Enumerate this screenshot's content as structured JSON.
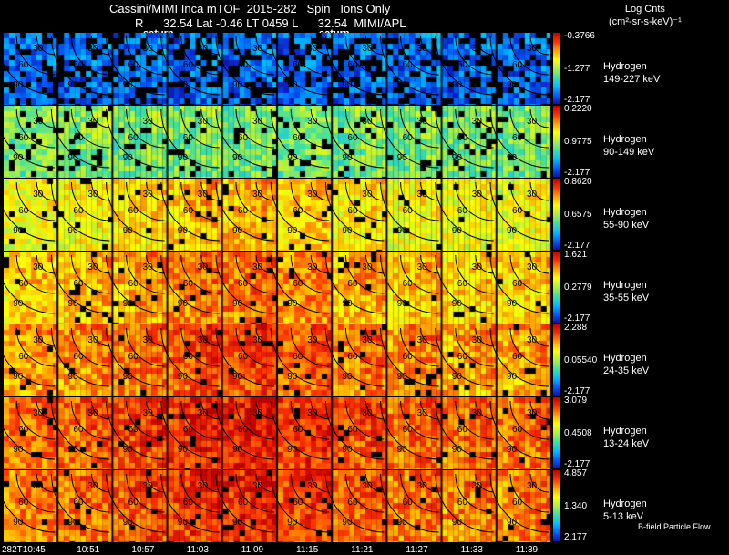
{
  "header": {
    "title": "Cassini/MIMI Inca mTOF  2015-282   Spin   Ions Only",
    "subtitle": "R      32.54 Lat -0.46 LT 0459 L      32.54  MIMI/APL",
    "colorbar_title": "Log Cnts",
    "colorbar_units": "(cm²-sr-s-keV)⁻¹"
  },
  "overlay_labels": [
    "saturn",
    "saturn"
  ],
  "chart_data": {
    "type": "heatmap",
    "time_ticks": [
      "282T10:45",
      "10:51",
      "10:57",
      "11:03",
      "11:09",
      "11:15",
      "11:21",
      "11:27",
      "11:33",
      "11:39"
    ],
    "contour_labels": [
      "30",
      "60",
      "90"
    ],
    "panels": [
      {
        "species": "Hydrogen",
        "energy": "149-227 keV",
        "cb_max": "-0.3766",
        "cb_mid": "-1.277",
        "cb_min": "-2.177"
      },
      {
        "species": "Hydrogen",
        "energy": "90-149 keV",
        "cb_max": "0.2220",
        "cb_mid": "0.9775",
        "cb_min": "-2.177"
      },
      {
        "species": "Hydrogen",
        "energy": "55-90 keV",
        "cb_max": "0.8620",
        "cb_mid": "0.6575",
        "cb_min": "-2.177"
      },
      {
        "species": "Hydrogen",
        "energy": "35-55 keV",
        "cb_max": "1.621",
        "cb_mid": "0.2779",
        "cb_min": "-2.177"
      },
      {
        "species": "Hydrogen",
        "energy": "24-35 keV",
        "cb_max": "2.288",
        "cb_mid": "0.05540",
        "cb_min": "-2.177"
      },
      {
        "species": "Hydrogen",
        "energy": "13-24 keV",
        "cb_max": "3.079",
        "cb_mid": "0.4508",
        "cb_min": "-2.177"
      },
      {
        "species": "Hydrogen",
        "energy": "5-13 keV",
        "cb_max": "4.857",
        "cb_mid": "1.340",
        "cb_min": "2.177"
      }
    ],
    "intensity_levels": [
      0.12,
      0.42,
      0.58,
      0.66,
      0.72,
      0.78,
      0.76
    ],
    "colormap": [
      "#1010b0",
      "#0060ff",
      "#00c0ff",
      "#40e0a0",
      "#b0f040",
      "#ffff00",
      "#ffa000",
      "#ff3000",
      "#c00000"
    ],
    "footer_label": "B-field Particle Flow"
  }
}
